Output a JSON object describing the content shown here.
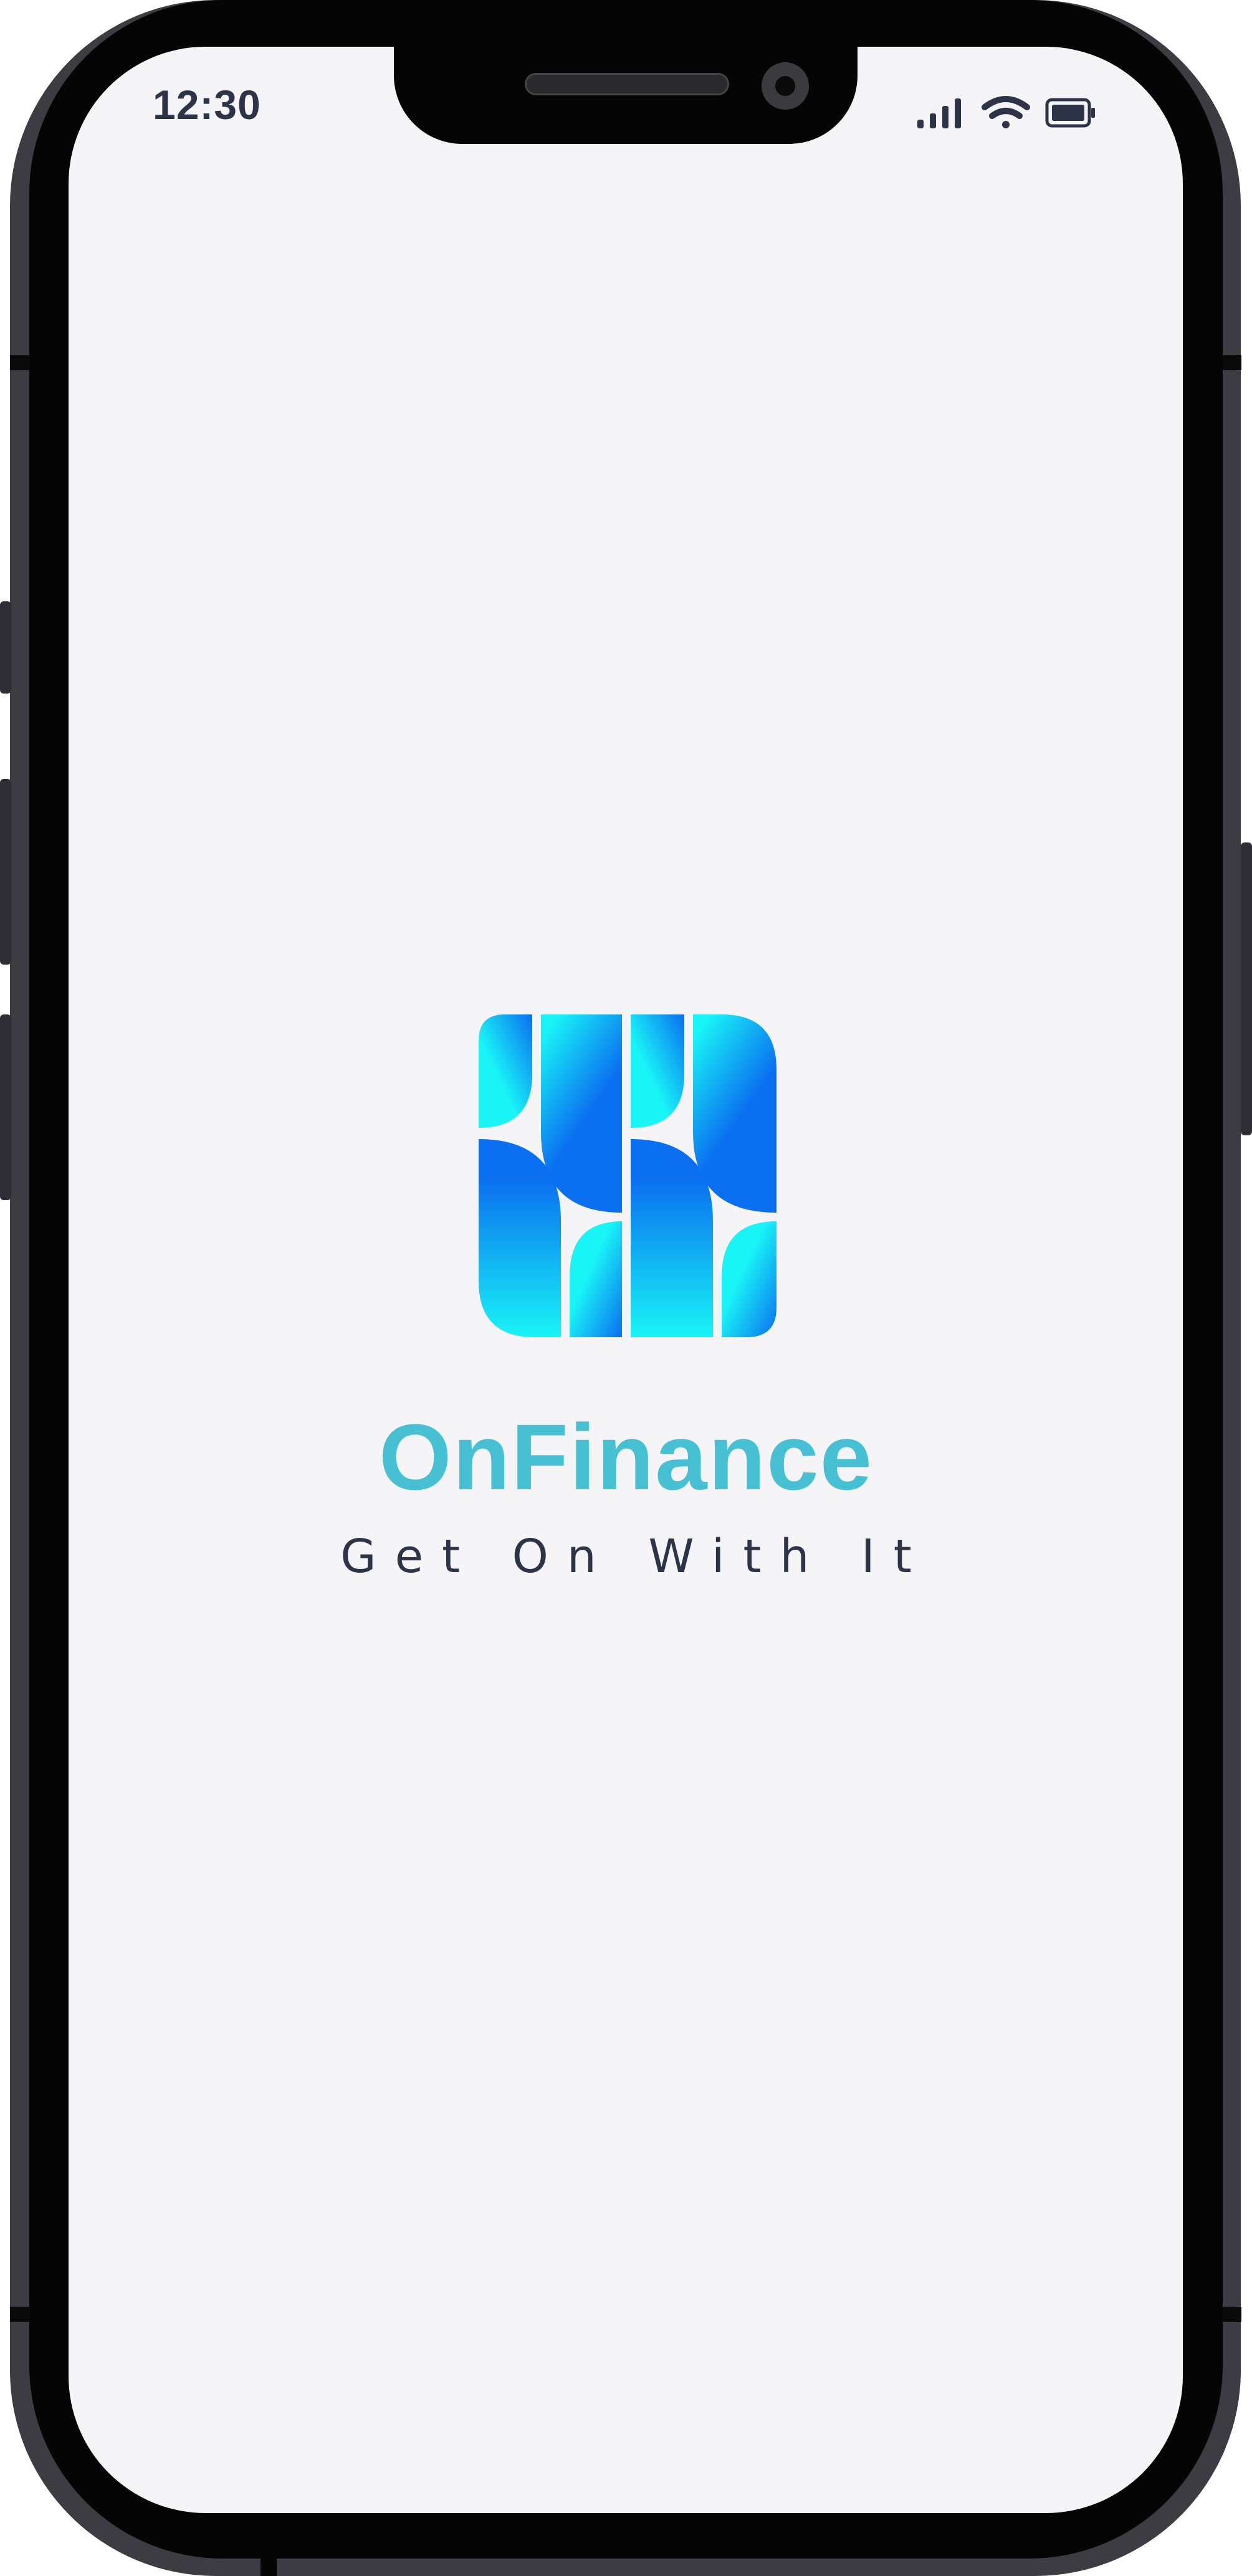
{
  "status_bar": {
    "time": "12:30",
    "signal_icon": "cellular-signal-icon",
    "wifi_icon": "wifi-icon",
    "battery_icon": "battery-icon"
  },
  "splash": {
    "logo_icon": "onfinance-logo-icon",
    "app_name": "OnFinance",
    "tagline": "Get On With It"
  },
  "colors": {
    "brand_text": "#47c0d3",
    "tagline_text": "#2e3447",
    "screen_background": "#f5f5f8",
    "logo_gradient_cyan": "#19f4f6",
    "logo_gradient_blue": "#0a6ff0"
  }
}
